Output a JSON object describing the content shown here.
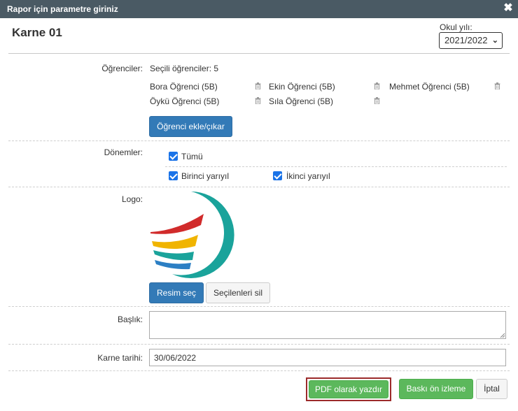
{
  "dialog": {
    "title": "Rapor için parametre giriniz",
    "close_glyph": "✖",
    "heading": "Karne 01",
    "school_year_label": "Okul yılı:",
    "school_year_value": "2021/2022"
  },
  "students": {
    "label": "Öğrenciler:",
    "selected_text": "Seçili öğrenciler: 5",
    "items": [
      {
        "name": "Bora Öğrenci (5B)"
      },
      {
        "name": "Ekin Öğrenci (5B)"
      },
      {
        "name": "Mehmet Öğrenci (5B)"
      },
      {
        "name": "Öykü Öğrenci (5B)"
      },
      {
        "name": "Sıla Öğrenci (5B)"
      }
    ],
    "edit_button": "Öğrenci ekle/çıkar"
  },
  "periods": {
    "label": "Dönemler:",
    "all": {
      "label": "Tümü",
      "checked": true
    },
    "first": {
      "label": "Birinci yarıyıl",
      "checked": true
    },
    "second": {
      "label": "İkinci yarıyıl",
      "checked": true
    }
  },
  "logo": {
    "label": "Logo:",
    "select_button": "Resim seç",
    "clear_button": "Seçilenleri sil",
    "colors": {
      "ring": "#1aa39b",
      "red": "#d12b2b",
      "yellow": "#f0b400",
      "teal": "#1aa39b",
      "blue": "#2c7fc4"
    }
  },
  "title_field": {
    "label": "Başlık:",
    "value": ""
  },
  "date_field": {
    "label": "Karne tarihi:",
    "value": "30/06/2022"
  },
  "footer": {
    "pdf_button": "PDF olarak yazdır",
    "preview_button": "Baskı ön izleme",
    "cancel_button": "İptal"
  }
}
